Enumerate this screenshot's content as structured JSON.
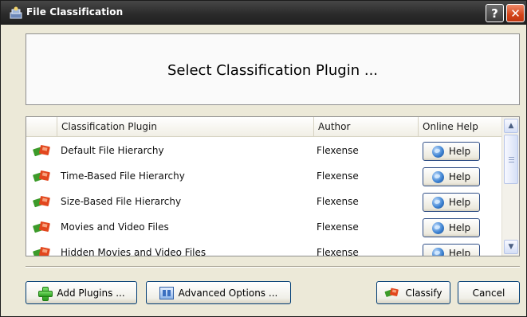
{
  "window": {
    "title": "File Classification",
    "help_glyph": "?",
    "close_glyph": "✕"
  },
  "header": {
    "title": "Select Classification Plugin ..."
  },
  "list": {
    "columns": {
      "plugin": "Classification Plugin",
      "author": "Author",
      "help": "Online Help"
    },
    "rows": [
      {
        "name": "Default File Hierarchy",
        "author": "Flexense",
        "help": "Help"
      },
      {
        "name": "Time-Based File Hierarchy",
        "author": "Flexense",
        "help": "Help"
      },
      {
        "name": "Size-Based File Hierarchy",
        "author": "Flexense",
        "help": "Help"
      },
      {
        "name": "Movies and Video Files",
        "author": "Flexense",
        "help": "Help"
      },
      {
        "name": "Hidden Movies and Video Files",
        "author": "Flexense",
        "help": "Help"
      }
    ],
    "scroll": {
      "up_glyph": "▲",
      "down_glyph": "▼"
    }
  },
  "buttons": {
    "add_plugins": "Add Plugins ...",
    "advanced_options": "Advanced Options ...",
    "classify": "Classify",
    "cancel": "Cancel"
  },
  "colors": {
    "titlebar": "#2b2b2b",
    "close": "#d24418",
    "window_bg": "#ece9d8",
    "button_border": "#003c74"
  },
  "icons": {
    "title": "app-icon",
    "row": "plugin-icon",
    "help": "globe-icon",
    "add": "plus-icon",
    "advanced": "options-icon"
  }
}
